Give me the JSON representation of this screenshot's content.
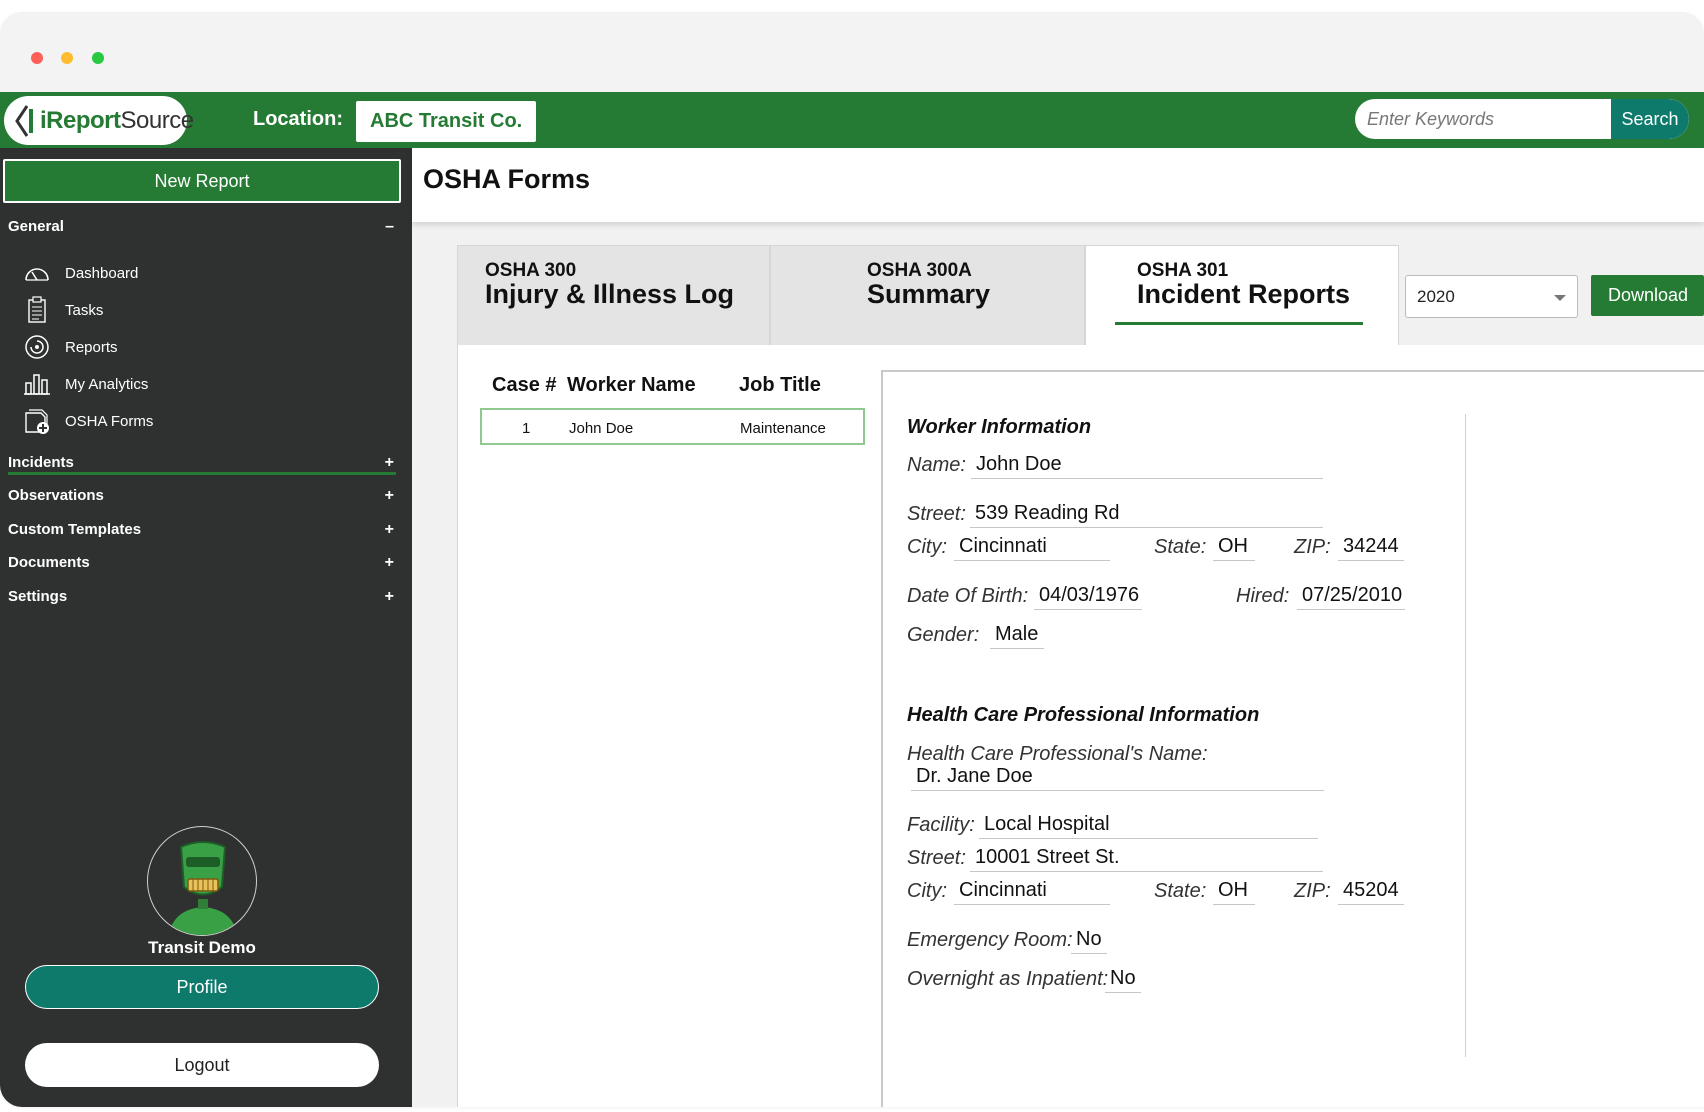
{
  "header": {
    "logo_prefix": "i",
    "logo_bold": "Report",
    "logo_rest": "Source",
    "location_label": "Location:",
    "location_value": "ABC Transit Co.",
    "search_placeholder": "Enter Keywords",
    "search_button": "Search"
  },
  "sidebar": {
    "new_report": "New Report",
    "general": {
      "label": "General",
      "toggle": "–"
    },
    "items": [
      {
        "label": "Dashboard",
        "icon": "dashboard-gauge-icon"
      },
      {
        "label": "Tasks",
        "icon": "clipboard-icon"
      },
      {
        "label": "Reports",
        "icon": "reports-spiral-icon"
      },
      {
        "label": "My Analytics",
        "icon": "bar-chart-icon"
      },
      {
        "label": "OSHA Forms",
        "icon": "osha-forms-icon"
      }
    ],
    "groups": [
      {
        "label": "Incidents",
        "toggle": "+"
      },
      {
        "label": "Observations",
        "toggle": "+"
      },
      {
        "label": "Custom Templates",
        "toggle": "+"
      },
      {
        "label": "Documents",
        "toggle": "+"
      },
      {
        "label": "Settings",
        "toggle": "+"
      }
    ],
    "profile_name": "Transit Demo",
    "profile_button": "Profile",
    "logout_button": "Logout"
  },
  "main": {
    "page_title": "OSHA Forms",
    "tabs": [
      {
        "sub": "OSHA 300",
        "main": "Injury & Illness Log",
        "active": false
      },
      {
        "sub": "OSHA 300A",
        "main": "Summary",
        "active": false
      },
      {
        "sub": "OSHA 301",
        "main": "Incident Reports",
        "active": true
      }
    ],
    "year": "2020",
    "download": "Download"
  },
  "case_table": {
    "headers": [
      "Case #",
      "Worker Name",
      "Job Title"
    ],
    "rows": [
      {
        "case": "1",
        "name": "John Doe",
        "job": "Maintenance"
      }
    ]
  },
  "worker": {
    "title": "Worker Information",
    "name_label": "Name:",
    "name": "John Doe",
    "street_label": "Street:",
    "street": "539 Reading Rd",
    "city_label": "City:",
    "city": "Cincinnati",
    "state_label": "State:",
    "state": "OH",
    "zip_label": "ZIP:",
    "zip": "34244",
    "dob_label": "Date Of Birth:",
    "dob": "04/03/1976",
    "hired_label": "Hired:",
    "hired": "07/25/2010",
    "gender_label": "Gender:",
    "gender": "Male"
  },
  "hcp": {
    "title": "Health Care Professional Information",
    "name_label": "Health Care Professional's Name:",
    "name": "Dr. Jane Doe",
    "facility_label": "Facility:",
    "facility": "Local Hospital",
    "street_label": "Street:",
    "street": "10001 Street St.",
    "city_label": "City:",
    "city": "Cincinnati",
    "state_label": "State:",
    "state": "OH",
    "zip_label": "ZIP:",
    "zip": "45204",
    "er_label": "Emergency Room:",
    "er": "No",
    "overnight_label": "Overnight as Inpatient:",
    "overnight": "No"
  },
  "colors": {
    "brand_green": "#267b34",
    "teal": "#0e7a6c",
    "sidebar_bg": "#2e3130"
  }
}
